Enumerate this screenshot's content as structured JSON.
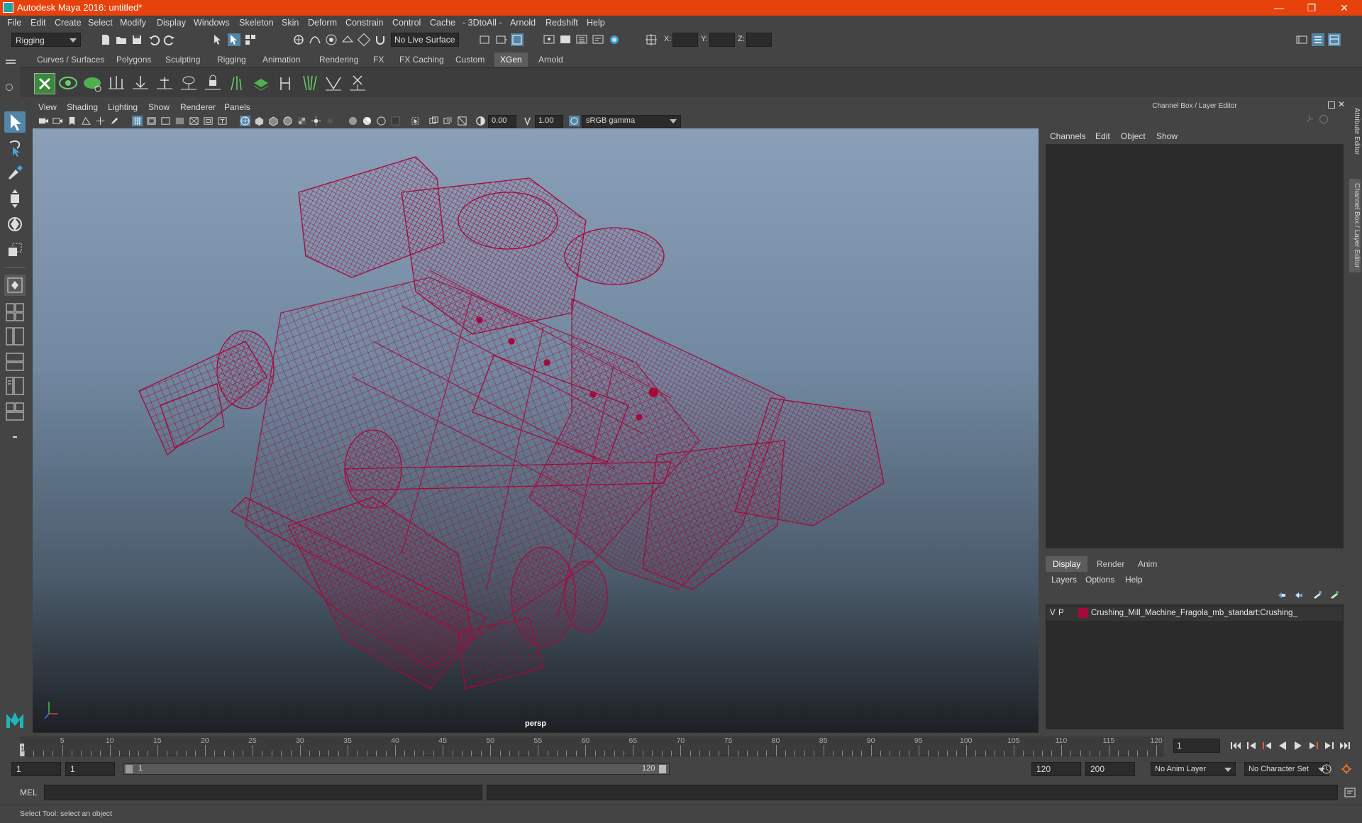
{
  "window": {
    "title": "Autodesk Maya 2016: untitled*",
    "minimize": "—",
    "maximize": "❐",
    "close": "✕"
  },
  "menubar": [
    "File",
    "Edit",
    "Create",
    "Select",
    "Modify",
    "Display",
    "Windows",
    "Skeleton",
    "Skin",
    "Deform",
    "Constrain",
    "Control",
    "Cache",
    "- 3DtoAll -",
    "Arnold",
    "Redshift",
    "Help"
  ],
  "statusline": {
    "menuset": "Rigging",
    "live_surface": "No Live Surface",
    "x_label": "X:",
    "y_label": "Y:",
    "z_label": "Z:"
  },
  "shelf_tabs": [
    "Curves / Surfaces",
    "Polygons",
    "Sculpting",
    "Rigging",
    "Animation",
    "Rendering",
    "FX",
    "FX Caching",
    "Custom",
    "XGen",
    "Arnold"
  ],
  "shelf_active": "XGen",
  "viewport": {
    "menu": [
      "View",
      "Shading",
      "Lighting",
      "Show",
      "Renderer",
      "Panels"
    ],
    "exposure": "0.00",
    "gamma": "1.00",
    "color_space": "sRGB gamma",
    "camera_label": "persp",
    "wire_color": "#a50a3a"
  },
  "channel_box": {
    "title": "Channel Box / Layer Editor",
    "menu": [
      "Channels",
      "Edit",
      "Object",
      "Show"
    ]
  },
  "side_tabs": [
    "Attribute Editor",
    "Channel Box / Layer Editor"
  ],
  "layer_editor": {
    "tabs": [
      "Display",
      "Render",
      "Anim"
    ],
    "active_tab": "Display",
    "menu": [
      "Layers",
      "Options",
      "Help"
    ],
    "layers": [
      {
        "v": "V",
        "p": "P",
        "color": "#a50a3a",
        "name": "Crushing_Mill_Machine_Fragola_mb_standart:Crushing_"
      }
    ]
  },
  "timeline": {
    "ticks": [
      "5",
      "10",
      "15",
      "20",
      "25",
      "30",
      "35",
      "40",
      "45",
      "50",
      "55",
      "60",
      "65",
      "70",
      "75",
      "80",
      "85",
      "90",
      "95",
      "100",
      "105",
      "110",
      "115",
      "120"
    ],
    "first_frame_label": "1",
    "current_frame": "1"
  },
  "range": {
    "start": "1",
    "playback_start": "1",
    "slider_start": "1",
    "slider_end": "120",
    "playback_end": "120",
    "end": "200",
    "anim_layer": "No Anim Layer",
    "character_set": "No Character Set"
  },
  "command_line": {
    "label": "MEL"
  },
  "help_line": "Select Tool: select an object"
}
